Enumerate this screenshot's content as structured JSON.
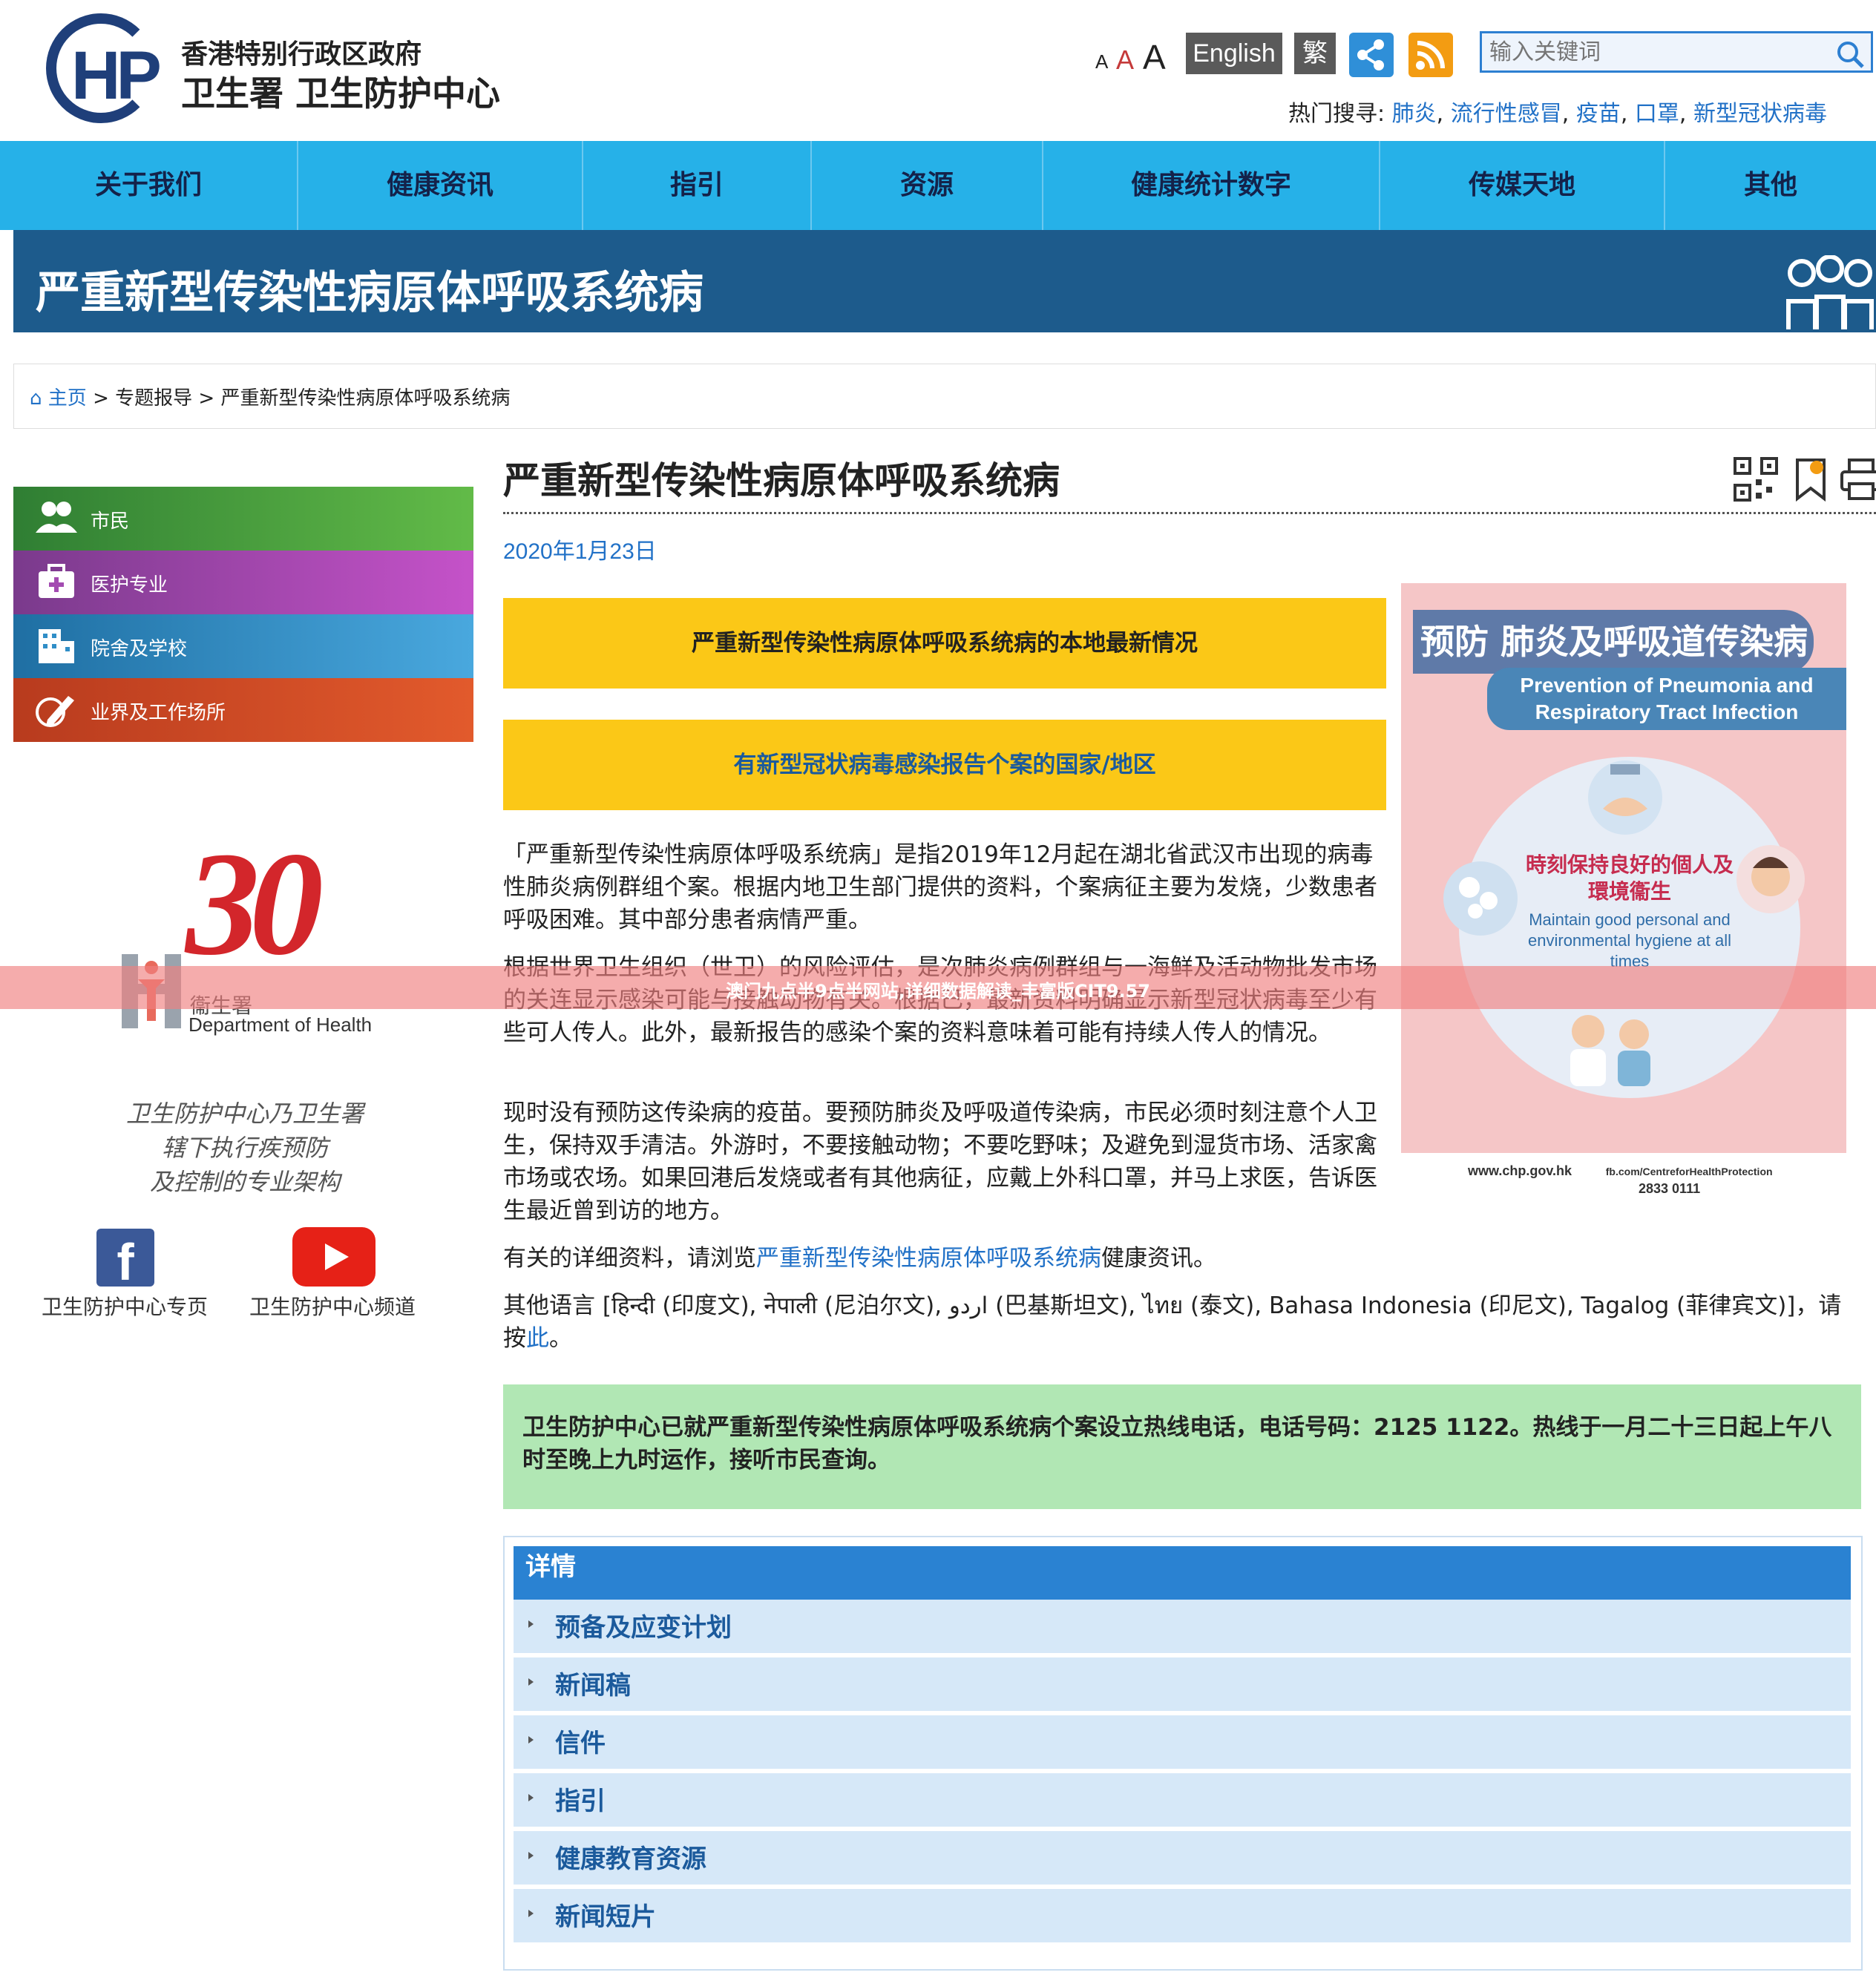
{
  "header": {
    "logo_letters": "HP",
    "org_line1": "香港特别行政区政府",
    "org_line2": "卫生署  卫生防护中心",
    "font_small": "A",
    "font_medium": "A",
    "font_large": "A",
    "lang_english": "English",
    "lang_traditional": "繁",
    "search_placeholder": "输入关键词",
    "hot_label": "热门搜寻:",
    "hot_terms": [
      "肺炎",
      "流行性感冒",
      "疫苗",
      "口罩",
      "新型冠状病毒"
    ],
    "hot_sep": ","
  },
  "nav": [
    "关于我们",
    "健康资讯",
    "指引",
    "资源",
    "健康统计数字",
    "传媒天地",
    "其他"
  ],
  "banner": {
    "title": "严重新型传染性病原体呼吸系统病"
  },
  "breadcrumb": {
    "home": "主页",
    "sep": ">",
    "level1": "专题报导",
    "current": "严重新型传染性病原体呼吸系统病"
  },
  "sidebar": {
    "items": [
      {
        "label": "市民",
        "icon": "people-icon",
        "color": "#4aa83e"
      },
      {
        "label": "医护专业",
        "icon": "medical-kit-icon",
        "color": "#a34bb1"
      },
      {
        "label": "院舍及学校",
        "icon": "building-icon",
        "color": "#2f8ec7"
      },
      {
        "label": "业界及工作场所",
        "icon": "pen-icon",
        "color": "#d24d2a"
      }
    ],
    "anniv_number": "30",
    "doh_zh": "衞生署",
    "doh_en": "Department of Health",
    "tagline": [
      "卫生防护中心乃卫生署",
      "辖下执行疾预防",
      "及控制的专业架构"
    ],
    "facebook_caption": "卫生防护中心专页",
    "youtube_caption": "卫生防护中心频道"
  },
  "main": {
    "title": "严重新型传染性病原体呼吸系统病",
    "date": "2020年1月23日",
    "button1": "严重新型传染性病原体呼吸系统病的本地最新情况",
    "button2": "有新型冠状病毒感染报告个案的国家/地区",
    "para1": "「严重新型传染性病原体呼吸系统病」是指2019年12月起在湖北省武汉市出现的病毒性肺炎病例群组个案。根据内地卫生部门提供的资料，个案病征主要为发烧，少数患者呼吸困难。其中部分患者病情严重。",
    "para2": "根据世界卫生组织（世卫）的风险评估，是次肺炎病例群组与一海鲜及活动物批发市场的关连显示感染可能与接触动物有关。根据已，最新资料明确显示新型冠状病毒至少有些可人传人。此外，最新报告的感染个案的资料意味着可能有持续人传人的情况。",
    "para3": "现时没有预防这传染病的疫苗。要预防肺炎及呼吸道传染病，市民必须时刻注意个人卫生，保持双手清洁。外游时，不要接触动物；不要吃野味；及避免到湿货市场、活家禽市场或农场。如果回港后发烧或者有其他病征，应戴上外科口罩，并马上求医，告诉医生最近曾到访的地方。",
    "para4_pre": "有关的详细资料，请浏览",
    "para4_link": "严重新型传染性病原体呼吸系统病",
    "para4_post": "健康资讯。",
    "para5_pre": "其他语言 [हिन्दी (印度文), नेपाली (尼泊尔文), اردو (巴基斯坦文), ไทย (泰文), Bahasa Indonesia (印尼文), Tagalog (菲律宾文)]，请按",
    "para5_link": "此",
    "para5_post": "。",
    "hotline": "卫生防护中心已就严重新型传染性病原体呼吸系统病个案设立热线电话，电话号码：2125 1122。热线于一月二十三日起上午八时至晚上九时运作，接听市民查询。",
    "details_header": "详情",
    "details_items": [
      "预备及应变计划",
      "新闻稿",
      "信件",
      "指引",
      "健康教育资源",
      "新闻短片"
    ]
  },
  "poster": {
    "title_zh": "预防 肺炎及呼吸道传染病",
    "title_en": "Prevention of Pneumonia and Respiratory Tract Infection",
    "center_zh": "時刻保持良好的個人及環境衞生",
    "center_en": "Maintain good personal and environmental hygiene at all times",
    "footer_web": "www.chp.gov.hk",
    "footer_fb": "fb.com/CentreforHealthProtection",
    "footer_phone": "2833 0111"
  },
  "overlay": {
    "text": "澳门九点半9点半网站,详细数据解读_丰富版CIT9.57"
  },
  "colors": {
    "nav": "#26b1e8",
    "banner": "#1d5b8c",
    "yellow": "#fbc817",
    "green": "#b1e7b4",
    "link": "#2171c7"
  }
}
